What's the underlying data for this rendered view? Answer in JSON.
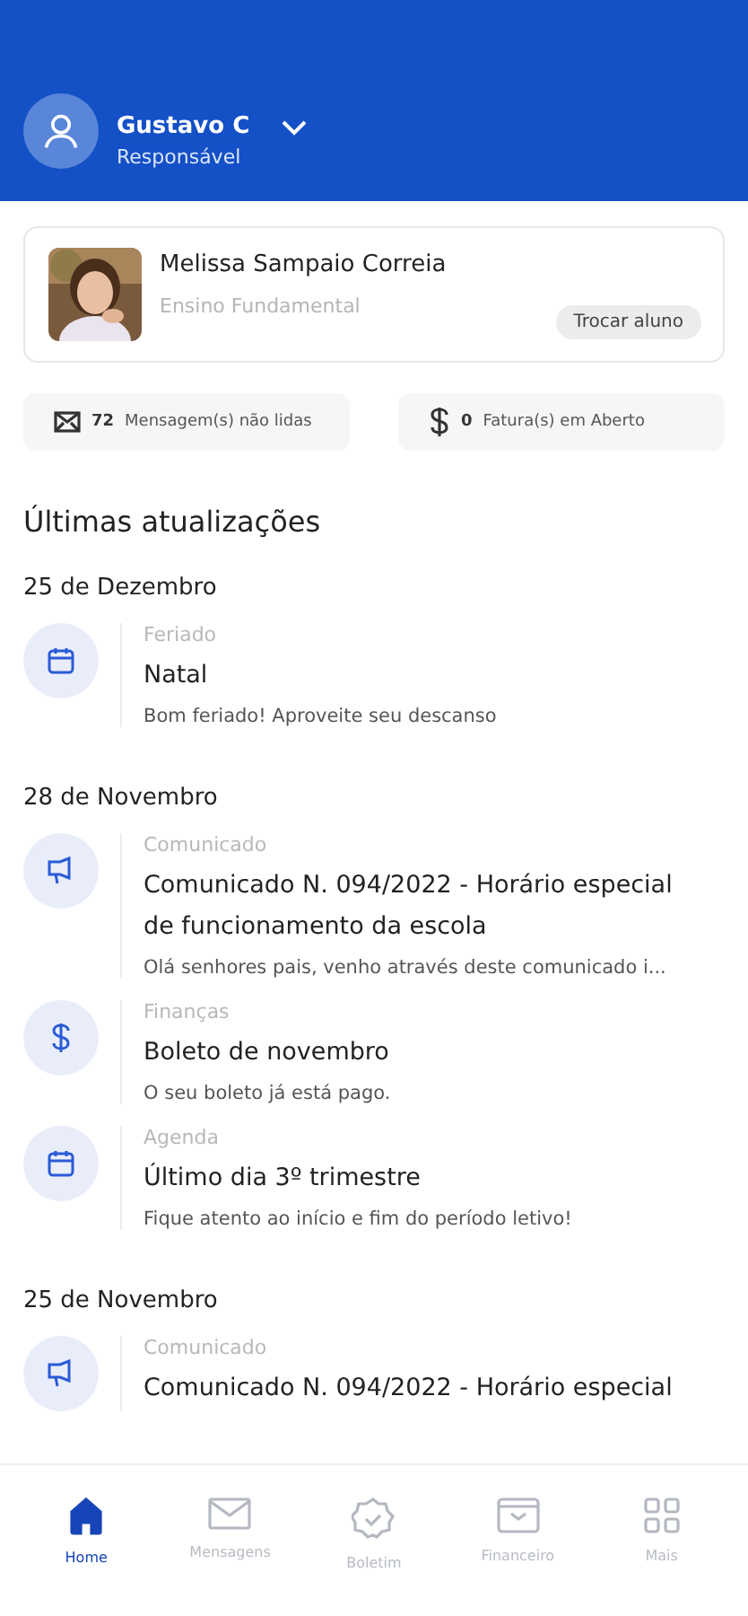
{
  "header": {
    "user_name": "Gustavo C",
    "role": "Responsável"
  },
  "student": {
    "name": "Melissa Sampaio Correia",
    "level": "Ensino Fundamental",
    "switch_button": "Trocar aluno"
  },
  "summary": [
    {
      "kind": "messages",
      "count": "72",
      "label": "Mensagem(s) não lidas"
    },
    {
      "kind": "invoices",
      "count": "0",
      "label": "Fatura(s) em Aberto"
    }
  ],
  "updates_title": "Últimas atualizações",
  "groups": [
    {
      "date": "25 de Dezembro",
      "items": [
        {
          "kind": "holiday",
          "category": "Feriado",
          "title": "Natal",
          "text": "Bom feriado! Aproveite seu descanso"
        }
      ]
    },
    {
      "date": "28 de Novembro",
      "items": [
        {
          "kind": "announcement",
          "category": "Comunicado",
          "title": "Comunicado N. 094/2022 - Horário especial de funcionamento da escola",
          "text": "Olá senhores pais, venho através deste comunicado i..."
        },
        {
          "kind": "finance",
          "category": "Finanças",
          "title": "Boleto de novembro",
          "text": "O seu boleto já está pago."
        },
        {
          "kind": "agenda",
          "category": "Agenda",
          "title": "Último dia 3º trimestre",
          "text": "Fique atento ao início e fim do período letivo!"
        }
      ]
    },
    {
      "date": "25 de Novembro",
      "items": [
        {
          "kind": "announcement",
          "category": "Comunicado",
          "title": "Comunicado N. 094/2022 - Horário especial"
        }
      ]
    }
  ],
  "nav": [
    {
      "kind": "home",
      "label": "Home",
      "selected": true
    },
    {
      "kind": "messages",
      "label": "Mensagens",
      "selected": false
    },
    {
      "kind": "report",
      "label": "Boletim",
      "selected": false
    },
    {
      "kind": "finance",
      "label": "Financeiro",
      "selected": false
    },
    {
      "kind": "more",
      "label": "Mais",
      "selected": false
    }
  ]
}
